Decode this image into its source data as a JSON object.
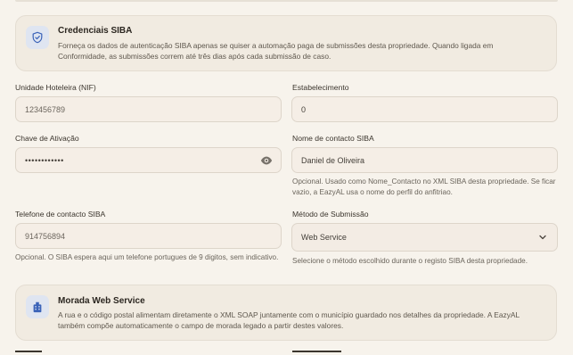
{
  "credentials_card": {
    "icon": "shield-check-icon",
    "title": "Credenciais SIBA",
    "description": "Forneça os dados de autenticação SIBA apenas se quiser a automação paga de submissões desta propriedade. Quando ligada em Conformidade, as submissões correm até três dias após cada submissão de caso."
  },
  "fields": {
    "nif": {
      "label": "Unidade Hoteleira (NIF)",
      "value": "123456789"
    },
    "establishment": {
      "label": "Estabelecimento",
      "value": "0"
    },
    "activation_key": {
      "label": "Chave de Ativação",
      "value": "••••••••••••"
    },
    "contact_name": {
      "label": "Nome de contacto SIBA",
      "value": "Daniel de Oliveira",
      "help": "Opcional. Usado como Nome_Contacto no XML SIBA desta propriedade. Se ficar vazio, a EazyAL usa o nome do perfil do anfitriao."
    },
    "contact_phone": {
      "label": "Telefone de contacto SIBA",
      "value": "914756894",
      "help": "Opcional. O SIBA espera aqui um telefone portugues de 9 digitos, sem indicativo."
    },
    "submission_method": {
      "label": "Método de Submissão",
      "value": "Web Service",
      "help": "Selecione o método escolhido durante o registo SIBA desta propriedade."
    }
  },
  "address_card": {
    "icon": "building-icon",
    "title": "Morada Web Service",
    "description": "A rua e o código postal alimentam diretamente o XML SOAP juntamente com o município guardado nos detalhes da propriedade. A EazyAL também compõe automaticamente o campo de morada legado a partir destes valores."
  },
  "colors": {
    "accent": "#3b63b8",
    "badge_bg": "#dfe5f1",
    "card_bg": "#f1ebe1",
    "page_bg": "#f7f3ec"
  }
}
